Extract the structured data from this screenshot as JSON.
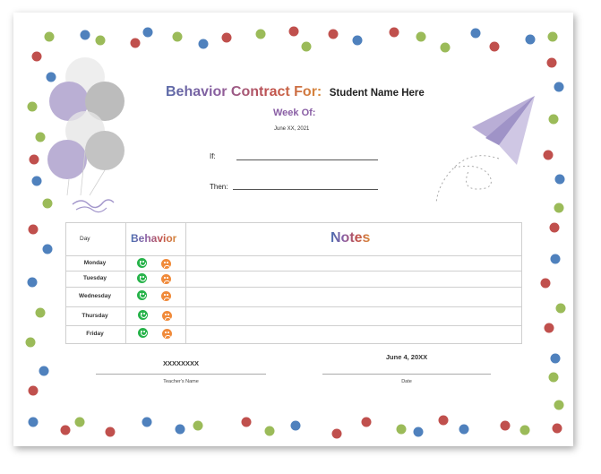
{
  "title": {
    "main": "Behavior Contract For:",
    "name": "Student Name Here"
  },
  "week_of_label": "Week Of:",
  "week_date": "June XX, 2021",
  "if_label": "If:",
  "then_label": "Then:",
  "table": {
    "headers": {
      "day": "Day",
      "behavior": "Behavior",
      "notes": "Notes"
    },
    "days": [
      "Monday",
      "Tuesday",
      "Wednesday",
      "Thursday",
      "Friday"
    ]
  },
  "signatures": {
    "teacher_value": "XXXXXXXX",
    "teacher_caption": "Teacher's Name",
    "date_value": "June 4, 20XX",
    "date_caption": "Date"
  },
  "colors": {
    "dot_red": "#c0504d",
    "dot_blue": "#4f81bd",
    "dot_green": "#9bbb59",
    "balloon_purple": "#b3a7d0",
    "balloon_gray": "#b5b5b5",
    "plane": "#b9aed6",
    "happy": "#27b34a",
    "sad": "#f08a3a"
  }
}
